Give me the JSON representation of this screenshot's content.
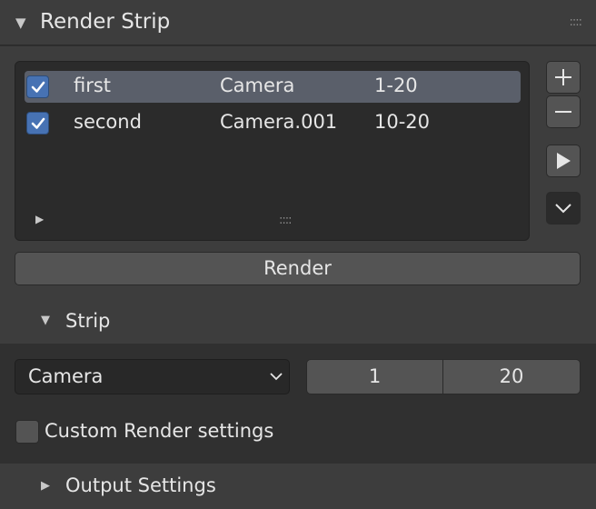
{
  "panel": {
    "title": "Render Strip",
    "expand_icon": "triangle-down-icon",
    "grip_icon": "drag-grip-icon"
  },
  "list": {
    "rows": [
      {
        "enabled": true,
        "name": "first",
        "camera": "Camera",
        "range": "1-20",
        "active": true
      },
      {
        "enabled": true,
        "name": "second",
        "camera": "Camera.001",
        "range": "10-20",
        "active": false
      }
    ]
  },
  "side_buttons": {
    "add_icon": "plus-icon",
    "remove_icon": "minus-icon",
    "play_icon": "play-icon",
    "menu_icon": "chevron-down-icon"
  },
  "render_button": {
    "label": "Render"
  },
  "strip": {
    "title": "Strip",
    "camera_select": {
      "value": "Camera"
    },
    "frame_start": "1",
    "frame_end": "20",
    "custom_render": {
      "label": "Custom Render settings",
      "checked": false
    }
  },
  "output": {
    "title": "Output Settings"
  },
  "colors": {
    "accent": "#4772b3",
    "panel_bg": "#3d3d3d",
    "list_bg": "#2b2b2b",
    "active_row": "#5a5f6a",
    "button_bg": "#545454"
  }
}
